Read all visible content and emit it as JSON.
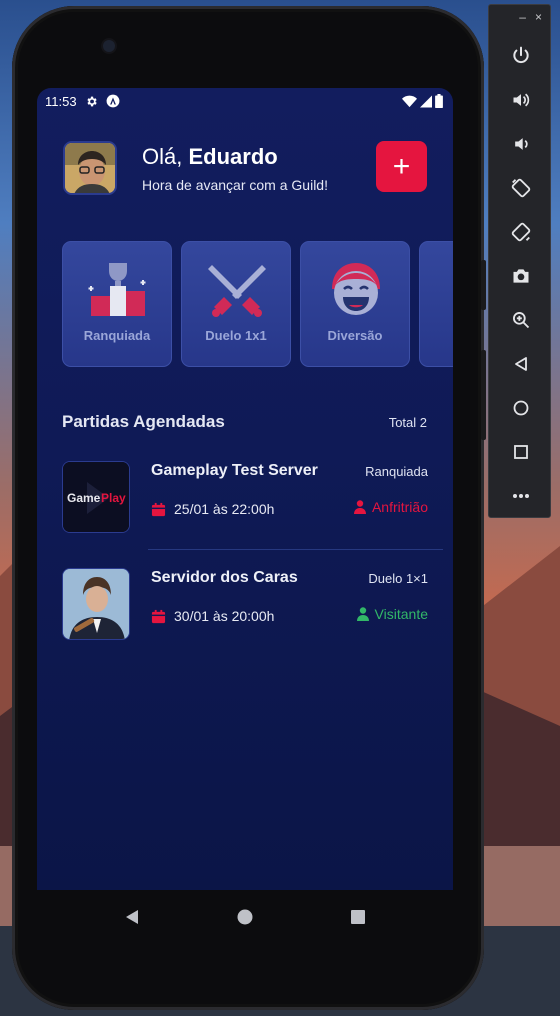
{
  "status_bar": {
    "time": "11:53"
  },
  "header": {
    "greeting_prefix": "Olá, ",
    "user_name": "Eduardo",
    "subtitle": "Hora de avançar com a Guild!",
    "add_button_label": "+"
  },
  "categories": [
    {
      "label": "Ranquiada",
      "icon": "podium-icon"
    },
    {
      "label": "Duelo 1x1",
      "icon": "crossed-swords-icon"
    },
    {
      "label": "Diversão",
      "icon": "laughing-face-icon"
    },
    {
      "label": "",
      "icon": "partial-category-icon"
    }
  ],
  "scheduled": {
    "title": "Partidas Agendadas",
    "total": "Total 2",
    "matches": [
      {
        "name": "Gameplay Test Server",
        "type": "Ranquiada",
        "date": "25/01 às 22:00h",
        "role": "Anfritrião",
        "role_color": "#e5153f",
        "thumb_text_a": "Game",
        "thumb_text_b": "Play"
      },
      {
        "name": "Servidor dos Caras",
        "type": "Duelo 1×1",
        "date": "30/01 às 20:00h",
        "role": "Visitante",
        "role_color": "#32b768"
      }
    ]
  },
  "toolbar": {
    "minimize": "–",
    "close": "×"
  },
  "colors": {
    "accent": "#e5153f",
    "background": "#0f1a56",
    "card": "#2f4196",
    "success": "#32b768"
  }
}
